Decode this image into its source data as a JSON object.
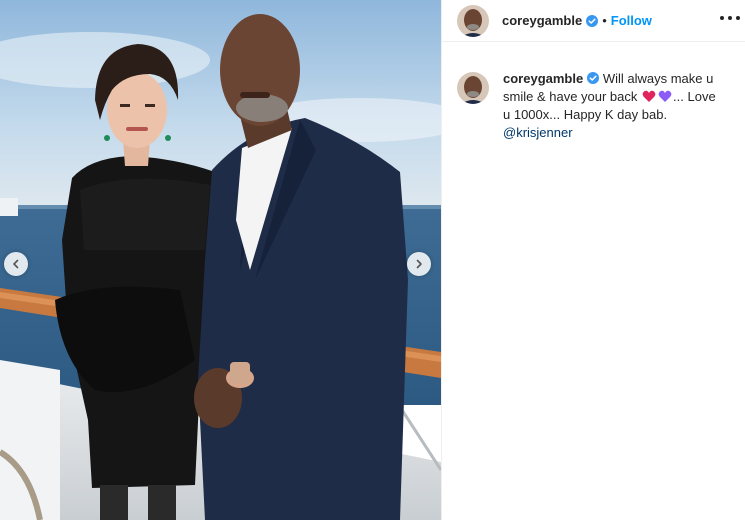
{
  "post": {
    "author": "coreygamble",
    "follow_label": "Follow",
    "separator": "•",
    "caption": {
      "username": "coreygamble",
      "text_before": "Will always make u smile & have your back",
      "heart1_color": "#e0245e",
      "heart2_color": "#8b5cf6",
      "text_after": "... Love u 1000x... Happy K day bab.",
      "mention": "@krisjenner"
    }
  },
  "colors": {
    "link_blue": "#0095f6",
    "mention": "#00376b",
    "verified": "#3897f0"
  },
  "icons": {
    "prev": "chevron-left-icon",
    "next": "chevron-right-icon",
    "more": "more-options-icon",
    "verified": "verified-badge-icon"
  }
}
